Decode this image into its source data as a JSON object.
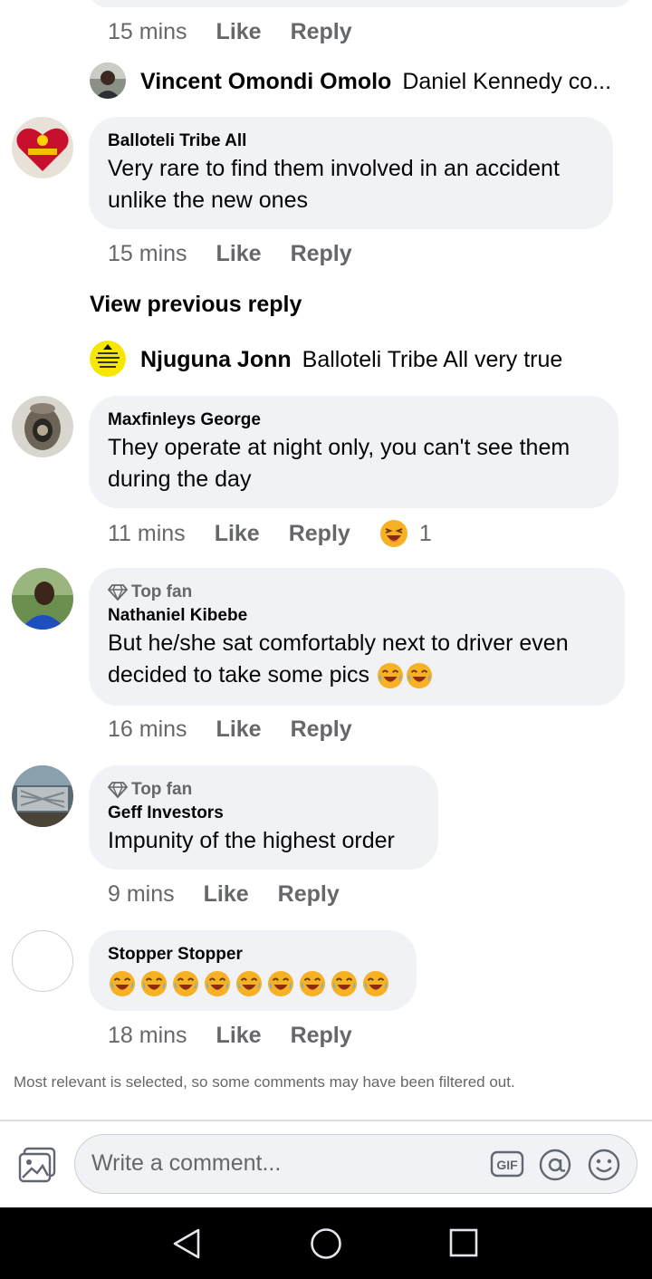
{
  "previous": {
    "time": "15 mins",
    "like_label": "Like",
    "reply_label": "Reply"
  },
  "reply1": {
    "name": "Vincent Omondi Omolo",
    "text": "Daniel Kennedy co..."
  },
  "comments": [
    {
      "name": "Balloteli Tribe All",
      "text": "Very rare to find them involved in an accident\nunlike the new ones",
      "time": "15 mins",
      "like": "Like",
      "reply": "Reply"
    },
    {
      "name": "Maxfinleys George",
      "text": "They operate at night only, you can't see them\nduring the day",
      "time": "11 mins",
      "like": "Like",
      "reply": "Reply",
      "reaction_count": "1"
    },
    {
      "badge": "Top fan",
      "name": "Nathaniel Kibebe",
      "text": "But he/she sat comfortably next to driver even\ndecided to take some pics",
      "time": "16 mins",
      "like": "Like",
      "reply": "Reply"
    },
    {
      "badge": "Top fan",
      "name": "Geff Investors",
      "text": "Impunity of the highest order",
      "time": "9 mins",
      "like": "Like",
      "reply": "Reply"
    },
    {
      "name": "Stopper Stopper",
      "time": "18 mins",
      "like": "Like",
      "reply": "Reply"
    }
  ],
  "view_previous_reply": "View previous reply",
  "reply2": {
    "name": "Njuguna Jonn",
    "text": "Balloteli Tribe All very true",
    "avatar_text": "KEEP CALM MY PROFILE PICTURE IS UNDER CONSTRUCTION"
  },
  "filter_note": "Most relevant is selected, so some comments may have been filtered out.",
  "composer": {
    "placeholder": "Write a comment...",
    "gif_label": "GIF"
  },
  "colors": {
    "bubble": "#f0f2f5",
    "meta_text": "#65676b",
    "primary_text": "#050505"
  },
  "icons": [
    "diamond-icon",
    "photo-icon",
    "gif-icon",
    "mention-icon",
    "emoji-icon",
    "nav-back-icon",
    "nav-home-icon",
    "nav-recents-icon",
    "laughing-emoji-icon",
    "squinting-emoji-icon"
  ]
}
